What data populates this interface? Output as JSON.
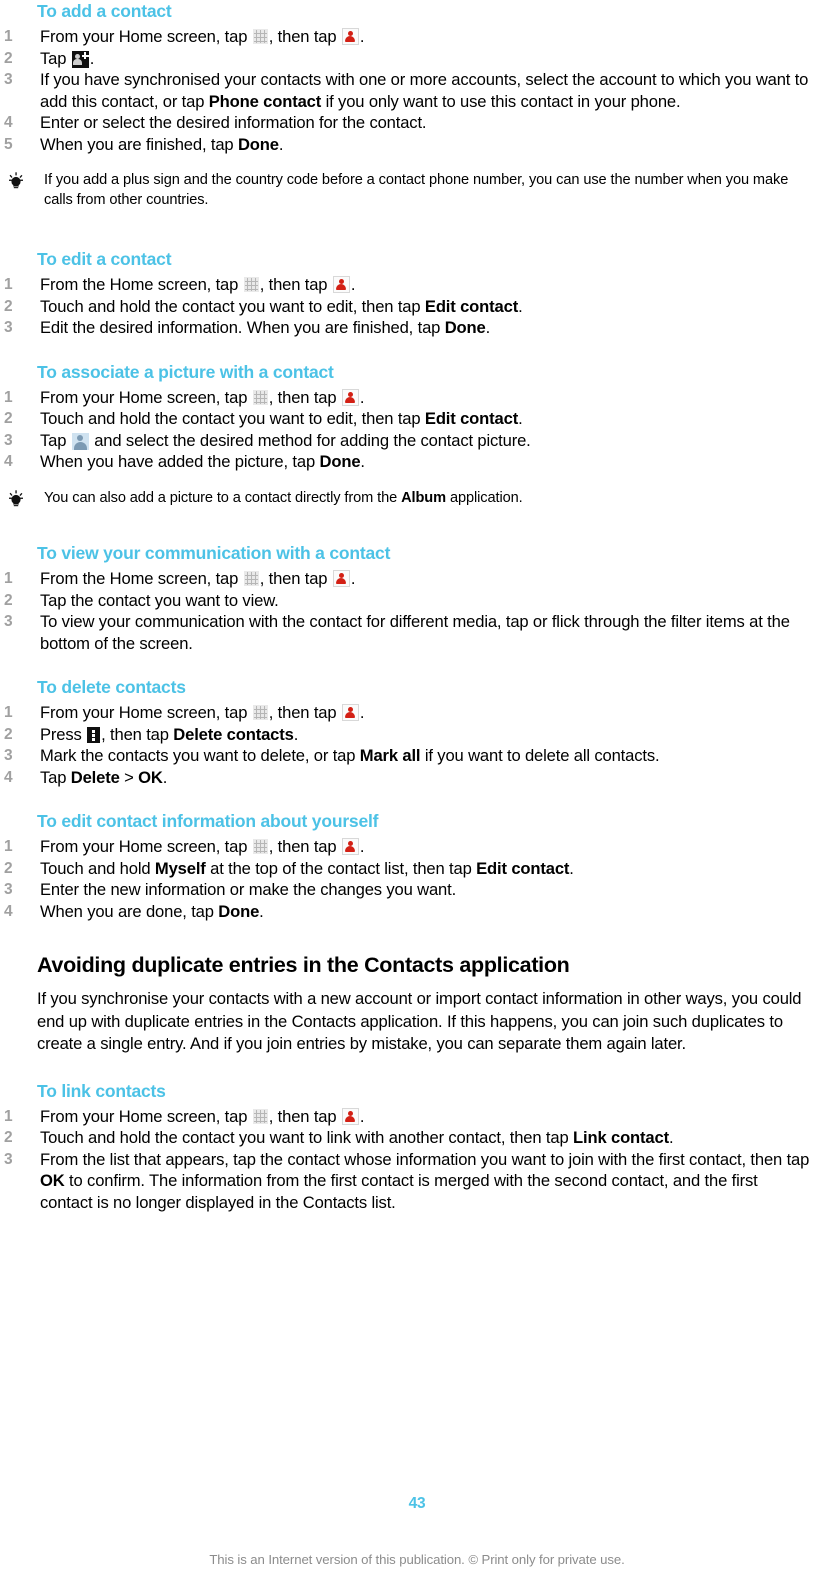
{
  "colors": {
    "heading_accent": "#4CC2E6",
    "step_number": "#A0A0A0",
    "body_text": "#000000",
    "footer_text": "#8C8C8C",
    "contacts_icon_red": "#D32015",
    "avatar_icon_blue": "#7C9AB3"
  },
  "icons": {
    "app_drawer": "grid-icon",
    "contacts": "contacts-person-icon",
    "add_contact": "add-contact-icon",
    "picture_placeholder": "avatar-placeholder-icon",
    "options_menu": "options-menu-icon",
    "tip": "lightbulb-tip-icon"
  },
  "sections": [
    {
      "id": "add-contact",
      "heading": "To add a contact",
      "steps": [
        {
          "num": "1",
          "parts": [
            {
              "t": "text",
              "v": "From your Home screen, tap "
            },
            {
              "t": "icon",
              "v": "app_drawer"
            },
            {
              "t": "text",
              "v": ", then tap "
            },
            {
              "t": "icon",
              "v": "contacts"
            },
            {
              "t": "text",
              "v": "."
            }
          ]
        },
        {
          "num": "2",
          "parts": [
            {
              "t": "text",
              "v": "Tap "
            },
            {
              "t": "icon",
              "v": "add_contact"
            },
            {
              "t": "text",
              "v": "."
            }
          ]
        },
        {
          "num": "3",
          "parts": [
            {
              "t": "text",
              "v": "If you have synchronised your contacts with one or more accounts, select the account to which you want to add this contact, or tap "
            },
            {
              "t": "bold",
              "v": "Phone contact"
            },
            {
              "t": "text",
              "v": " if you only want to use this contact in your phone."
            }
          ]
        },
        {
          "num": "4",
          "parts": [
            {
              "t": "text",
              "v": "Enter or select the desired information for the contact."
            }
          ]
        },
        {
          "num": "5",
          "parts": [
            {
              "t": "text",
              "v": "When you are finished, tap "
            },
            {
              "t": "bold",
              "v": "Done"
            },
            {
              "t": "text",
              "v": "."
            }
          ]
        }
      ],
      "tip": [
        {
          "t": "text",
          "v": "If you add a plus sign and the country code before a contact phone number, you can use the number when you make calls from other countries."
        }
      ]
    },
    {
      "id": "edit-contact",
      "heading": "To edit a contact",
      "steps": [
        {
          "num": "1",
          "parts": [
            {
              "t": "text",
              "v": "From the Home screen, tap "
            },
            {
              "t": "icon",
              "v": "app_drawer"
            },
            {
              "t": "text",
              "v": ", then tap "
            },
            {
              "t": "icon",
              "v": "contacts"
            },
            {
              "t": "text",
              "v": "."
            }
          ]
        },
        {
          "num": "2",
          "parts": [
            {
              "t": "text",
              "v": "Touch and hold the contact you want to edit, then tap "
            },
            {
              "t": "bold",
              "v": "Edit contact"
            },
            {
              "t": "text",
              "v": "."
            }
          ]
        },
        {
          "num": "3",
          "parts": [
            {
              "t": "text",
              "v": "Edit the desired information. When you are finished, tap "
            },
            {
              "t": "bold",
              "v": "Done"
            },
            {
              "t": "text",
              "v": "."
            }
          ]
        }
      ]
    },
    {
      "id": "associate-picture",
      "heading": "To associate a picture with a contact",
      "steps": [
        {
          "num": "1",
          "parts": [
            {
              "t": "text",
              "v": "From your Home screen, tap "
            },
            {
              "t": "icon",
              "v": "app_drawer"
            },
            {
              "t": "text",
              "v": ", then tap "
            },
            {
              "t": "icon",
              "v": "contacts"
            },
            {
              "t": "text",
              "v": "."
            }
          ]
        },
        {
          "num": "2",
          "parts": [
            {
              "t": "text",
              "v": "Touch and hold the contact you want to edit, then tap "
            },
            {
              "t": "bold",
              "v": "Edit contact"
            },
            {
              "t": "text",
              "v": "."
            }
          ]
        },
        {
          "num": "3",
          "parts": [
            {
              "t": "text",
              "v": "Tap "
            },
            {
              "t": "icon",
              "v": "picture_placeholder"
            },
            {
              "t": "text",
              "v": " and select the desired method for adding the contact picture."
            }
          ]
        },
        {
          "num": "4",
          "parts": [
            {
              "t": "text",
              "v": "When you have added the picture, tap "
            },
            {
              "t": "bold",
              "v": "Done"
            },
            {
              "t": "text",
              "v": "."
            }
          ]
        }
      ],
      "tip": [
        {
          "t": "text",
          "v": "You can also add a picture to a contact directly from the "
        },
        {
          "t": "bold",
          "v": "Album"
        },
        {
          "t": "text",
          "v": " application."
        }
      ]
    },
    {
      "id": "view-communication",
      "heading": "To view your communication with a contact",
      "steps": [
        {
          "num": "1",
          "parts": [
            {
              "t": "text",
              "v": "From the Home screen, tap "
            },
            {
              "t": "icon",
              "v": "app_drawer"
            },
            {
              "t": "text",
              "v": ", then tap "
            },
            {
              "t": "icon",
              "v": "contacts"
            },
            {
              "t": "text",
              "v": "."
            }
          ]
        },
        {
          "num": "2",
          "parts": [
            {
              "t": "text",
              "v": "Tap the contact you want to view."
            }
          ]
        },
        {
          "num": "3",
          "parts": [
            {
              "t": "text",
              "v": "To view your communication with the contact for different media, tap or flick through the filter items at the bottom of the screen."
            }
          ]
        }
      ]
    },
    {
      "id": "delete-contacts",
      "heading": "To delete contacts",
      "steps": [
        {
          "num": "1",
          "parts": [
            {
              "t": "text",
              "v": "From your Home screen, tap "
            },
            {
              "t": "icon",
              "v": "app_drawer"
            },
            {
              "t": "text",
              "v": ", then tap "
            },
            {
              "t": "icon",
              "v": "contacts"
            },
            {
              "t": "text",
              "v": "."
            }
          ]
        },
        {
          "num": "2",
          "parts": [
            {
              "t": "text",
              "v": "Press "
            },
            {
              "t": "icon",
              "v": "options_menu"
            },
            {
              "t": "text",
              "v": ", then tap "
            },
            {
              "t": "bold",
              "v": "Delete contacts"
            },
            {
              "t": "text",
              "v": "."
            }
          ]
        },
        {
          "num": "3",
          "parts": [
            {
              "t": "text",
              "v": "Mark the contacts you want to delete, or tap "
            },
            {
              "t": "bold",
              "v": "Mark all"
            },
            {
              "t": "text",
              "v": " if you want to delete all contacts."
            }
          ]
        },
        {
          "num": "4",
          "parts": [
            {
              "t": "text",
              "v": "Tap "
            },
            {
              "t": "bold",
              "v": "Delete"
            },
            {
              "t": "text",
              "v": " > "
            },
            {
              "t": "bold",
              "v": "OK"
            },
            {
              "t": "text",
              "v": "."
            }
          ]
        }
      ]
    },
    {
      "id": "edit-own-info",
      "heading": "To edit contact information about yourself",
      "steps": [
        {
          "num": "1",
          "parts": [
            {
              "t": "text",
              "v": "From your Home screen, tap "
            },
            {
              "t": "icon",
              "v": "app_drawer"
            },
            {
              "t": "text",
              "v": ", then tap "
            },
            {
              "t": "icon",
              "v": "contacts"
            },
            {
              "t": "text",
              "v": "."
            }
          ]
        },
        {
          "num": "2",
          "parts": [
            {
              "t": "text",
              "v": "Touch and hold "
            },
            {
              "t": "bold",
              "v": "Myself"
            },
            {
              "t": "text",
              "v": " at the top of the contact list, then tap "
            },
            {
              "t": "bold",
              "v": "Edit contact"
            },
            {
              "t": "text",
              "v": "."
            }
          ]
        },
        {
          "num": "3",
          "parts": [
            {
              "t": "text",
              "v": "Enter the new information or make the changes you want."
            }
          ]
        },
        {
          "num": "4",
          "parts": [
            {
              "t": "text",
              "v": "When you are done, tap "
            },
            {
              "t": "bold",
              "v": "Done"
            },
            {
              "t": "text",
              "v": "."
            }
          ]
        }
      ]
    }
  ],
  "major_section": {
    "heading": "Avoiding duplicate entries in the Contacts application",
    "paragraph": "If you synchronise your contacts with a new account or import contact information in other ways, you could end up with duplicate entries in the Contacts application. If this happens, you can join such duplicates to create a single entry. And if you join entries by mistake, you can separate them again later."
  },
  "link_contacts": {
    "heading": "To link contacts",
    "steps": [
      {
        "num": "1",
        "parts": [
          {
            "t": "text",
            "v": "From your Home screen, tap "
          },
          {
            "t": "icon",
            "v": "app_drawer"
          },
          {
            "t": "text",
            "v": ", then tap "
          },
          {
            "t": "icon",
            "v": "contacts"
          },
          {
            "t": "text",
            "v": "."
          }
        ]
      },
      {
        "num": "2",
        "parts": [
          {
            "t": "text",
            "v": "Touch and hold the contact you want to link with another contact, then tap "
          },
          {
            "t": "bold",
            "v": "Link contact"
          },
          {
            "t": "text",
            "v": "."
          }
        ]
      },
      {
        "num": "3",
        "parts": [
          {
            "t": "text",
            "v": "From the list that appears, tap the contact whose information you want to join with the first contact, then tap "
          },
          {
            "t": "bold",
            "v": "OK"
          },
          {
            "t": "text",
            "v": " to confirm. The information from the first contact is merged with the second contact, and the first contact is no longer displayed in the Contacts list."
          }
        ]
      }
    ]
  },
  "footer": {
    "page_number": "43",
    "note": "This is an Internet version of this publication. © Print only for private use."
  }
}
